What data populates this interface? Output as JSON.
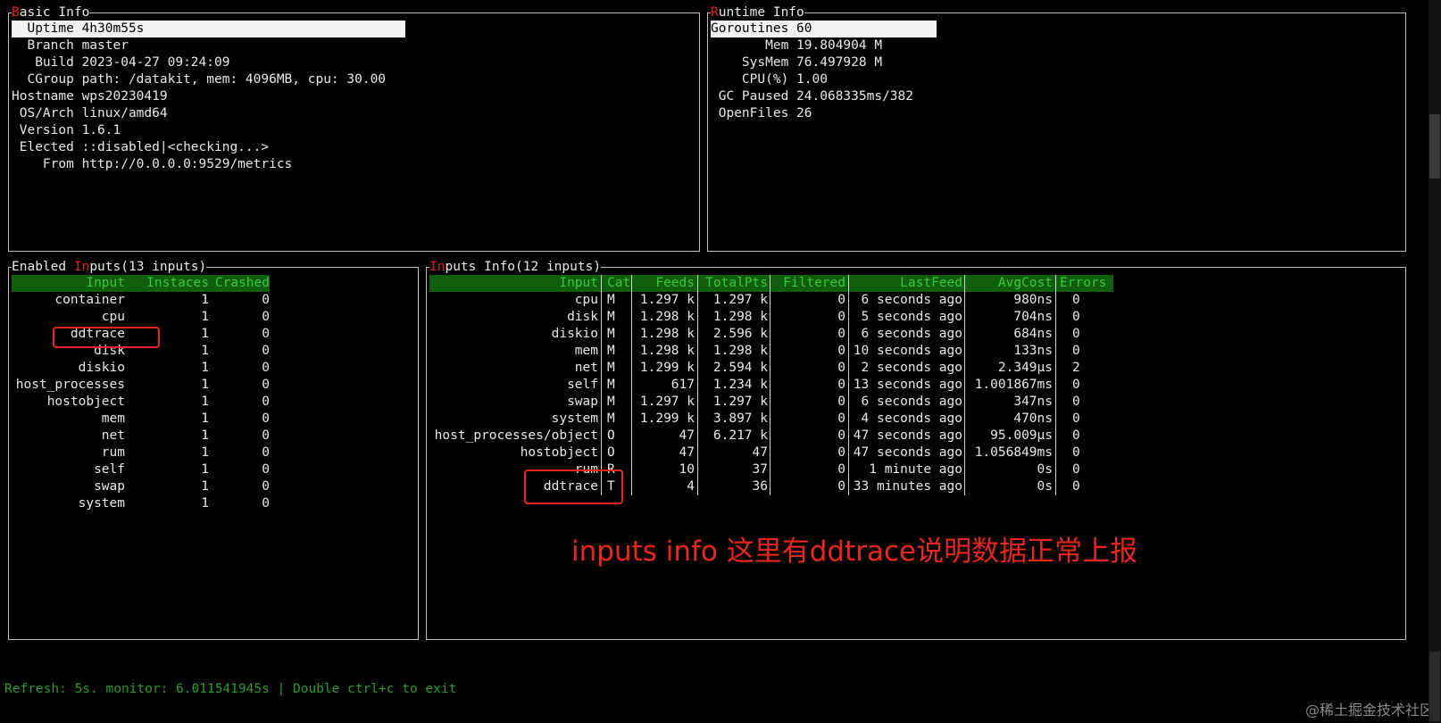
{
  "basic_info": {
    "title_first": "B",
    "title_rest": "asic Info",
    "rows": [
      {
        "label": "  Uptime",
        "value": "4h30m55s"
      },
      {
        "label": "  Branch",
        "value": "master"
      },
      {
        "label": "   Build",
        "value": "2023-04-27 09:24:09"
      },
      {
        "label": "  CGroup",
        "value": "path: /datakit, mem: 4096MB, cpu: 30.00"
      },
      {
        "label": "Hostname",
        "value": "wps20230419"
      },
      {
        "label": " OS/Arch",
        "value": "linux/amd64"
      },
      {
        "label": " Version",
        "value": "1.6.1"
      },
      {
        "label": " Elected",
        "value": "::disabled|<checking...>"
      },
      {
        "label": "    From",
        "value": "http://0.0.0.0:9529/metrics"
      }
    ]
  },
  "runtime_info": {
    "title_first": "R",
    "title_rest": "untime Info",
    "rows": [
      {
        "label": "Goroutines",
        "value": "60"
      },
      {
        "label": "       Mem",
        "value": "19.804904 M"
      },
      {
        "label": "    SysMem",
        "value": "76.497928 M"
      },
      {
        "label": "    CPU(%)",
        "value": "1.00"
      },
      {
        "label": " GC Paused",
        "value": "24.068335ms/382"
      },
      {
        "label": " OpenFiles",
        "value": "26"
      }
    ]
  },
  "enabled_inputs": {
    "title_a": "Enabled ",
    "title_b": "In",
    "title_c": "puts(13 inputs)",
    "headers": [
      "Input",
      "Instaces",
      "Crashed"
    ],
    "rows": [
      [
        "container",
        "1",
        "0"
      ],
      [
        "cpu",
        "1",
        "0"
      ],
      [
        "ddtrace",
        "1",
        "0"
      ],
      [
        "disk",
        "1",
        "0"
      ],
      [
        "diskio",
        "1",
        "0"
      ],
      [
        "host_processes",
        "1",
        "0"
      ],
      [
        "hostobject",
        "1",
        "0"
      ],
      [
        "mem",
        "1",
        "0"
      ],
      [
        "net",
        "1",
        "0"
      ],
      [
        "rum",
        "1",
        "0"
      ],
      [
        "self",
        "1",
        "0"
      ],
      [
        "swap",
        "1",
        "0"
      ],
      [
        "system",
        "1",
        "0"
      ]
    ]
  },
  "inputs_info": {
    "title_a": "In",
    "title_b": "puts Info(12 inputs)",
    "headers": [
      "Input",
      "Cat",
      "Feeds",
      "TotalPts",
      "Filtered",
      "LastFeed",
      "AvgCost",
      "Errors"
    ],
    "rows": [
      [
        "cpu",
        "M",
        "1.297 k",
        "1.297 k",
        "0",
        "6 seconds ago",
        "980ns",
        "0"
      ],
      [
        "disk",
        "M",
        "1.298 k",
        "1.298 k",
        "0",
        "5 seconds ago",
        "704ns",
        "0"
      ],
      [
        "diskio",
        "M",
        "1.298 k",
        "2.596 k",
        "0",
        "6 seconds ago",
        "684ns",
        "0"
      ],
      [
        "mem",
        "M",
        "1.298 k",
        "1.298 k",
        "0",
        "10 seconds ago",
        "133ns",
        "0"
      ],
      [
        "net",
        "M",
        "1.299 k",
        "2.594 k",
        "0",
        "2 seconds ago",
        "2.349µs",
        "2"
      ],
      [
        "self",
        "M",
        "617",
        "1.234 k",
        "0",
        "13 seconds ago",
        "1.001867ms",
        "0"
      ],
      [
        "swap",
        "M",
        "1.297 k",
        "1.297 k",
        "0",
        "6 seconds ago",
        "347ns",
        "0"
      ],
      [
        "system",
        "M",
        "1.299 k",
        "3.897 k",
        "0",
        "4 seconds ago",
        "470ns",
        "0"
      ],
      [
        "host_processes/object",
        "O",
        "47",
        "6.217 k",
        "0",
        "47 seconds ago",
        "95.009µs",
        "0"
      ],
      [
        "hostobject",
        "O",
        "47",
        "47",
        "0",
        "47 seconds ago",
        "1.056849ms",
        "0"
      ],
      [
        "rum",
        "R",
        "10",
        "37",
        "0",
        "1 minute ago",
        "0s",
        "0"
      ],
      [
        "ddtrace",
        "T",
        "4",
        "36",
        "0",
        "33 minutes ago",
        "0s",
        "0"
      ]
    ]
  },
  "annotation": "inputs info 这里有ddtrace说明数据正常上报",
  "status_bar": "Refresh: 5s. monitor: 6.011541945s | Double ctrl+c to exit",
  "watermark": "@稀土掘金技术社区",
  "colors": {
    "accent_red": "#e8281f",
    "header_green": "#0f5f0f",
    "status_green": "#2c9b2c"
  }
}
